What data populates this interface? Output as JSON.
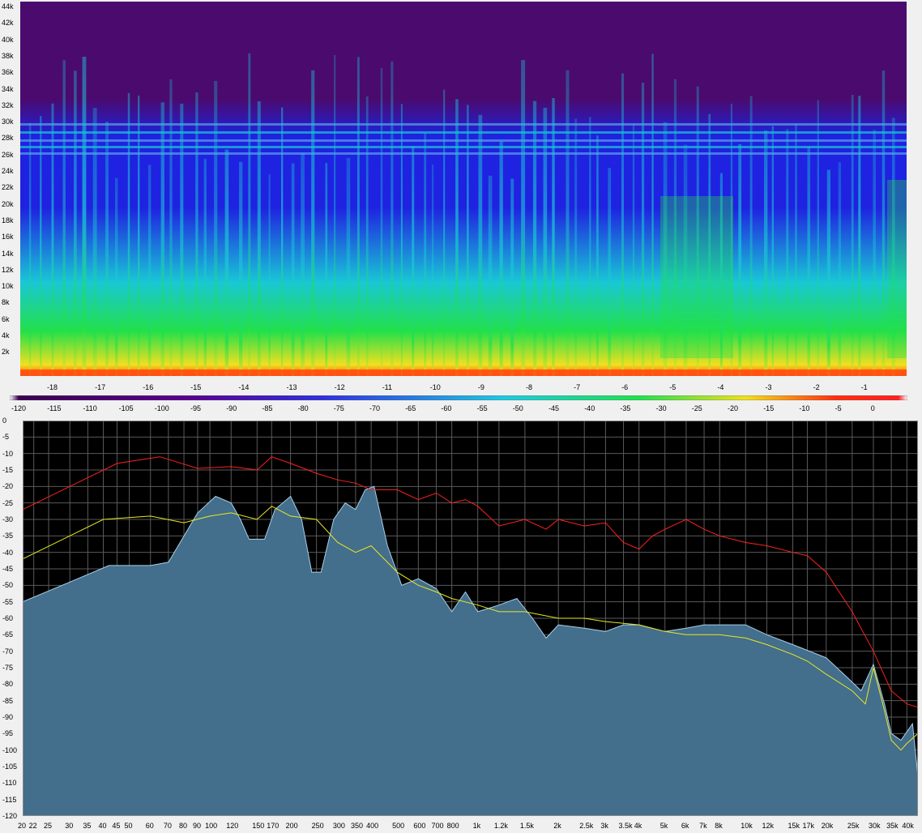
{
  "spectrogram": {
    "freq_ticks": [
      "44k",
      "42k",
      "40k",
      "38k",
      "36k",
      "34k",
      "32k",
      "30k",
      "28k",
      "26k",
      "24k",
      "22k",
      "20k",
      "18k",
      "16k",
      "14k",
      "12k",
      "10k",
      "8k",
      "6k",
      "4k",
      "2k"
    ],
    "time_ticks": [
      "-18",
      "-17",
      "-16",
      "-15",
      "-14",
      "-13",
      "-12",
      "-11",
      "-10",
      "-9",
      "-8",
      "-7",
      "-6",
      "-5",
      "-4",
      "-3",
      "-2",
      "-1"
    ],
    "colors": {
      "low": "#4a0a6e",
      "mid": "#1f22e0",
      "cyan": "#19c7d6",
      "green": "#22e04a",
      "hot": "#f0e020",
      "peak": "#ff5010"
    }
  },
  "color_scale": {
    "ticks": [
      "-120",
      "-115",
      "-110",
      "-105",
      "-100",
      "-95",
      "-90",
      "-85",
      "-80",
      "-75",
      "-70",
      "-65",
      "-60",
      "-55",
      "-50",
      "-45",
      "-40",
      "-35",
      "-30",
      "-25",
      "-20",
      "-15",
      "-10",
      "-5",
      "0"
    ]
  },
  "chart_data": {
    "type": "area",
    "x_scale": "log",
    "xlim": [
      20,
      44000
    ],
    "ylim": [
      -120,
      0
    ],
    "grid": true,
    "x_ticks": [
      "20",
      "22",
      "25",
      "30",
      "35",
      "40",
      "45",
      "50",
      "60",
      "70",
      "80",
      "90",
      "100",
      "120",
      "150",
      "170",
      "200",
      "250",
      "300",
      "350",
      "400",
      "500",
      "600",
      "700",
      "800",
      "1k",
      "1.2k",
      "1.5k",
      "2k",
      "2.5k",
      "3k",
      "3.5k",
      "4k",
      "5k",
      "6k",
      "7k",
      "8k",
      "10k",
      "12k",
      "15k",
      "17k",
      "20k",
      "25k",
      "30k",
      "35k",
      "40k"
    ],
    "y_ticks": [
      "0",
      "-5",
      "-10",
      "-15",
      "-20",
      "-25",
      "-30",
      "-35",
      "-40",
      "-45",
      "-50",
      "-55",
      "-60",
      "-65",
      "-70",
      "-75",
      "-80",
      "-85",
      "-90",
      "-95",
      "-100",
      "-105",
      "-110",
      "-115",
      "-120"
    ],
    "series": [
      {
        "color": "#ff2020",
        "points": [
          [
            20,
            -27
          ],
          [
            30,
            -20
          ],
          [
            45,
            -13
          ],
          [
            65,
            -11
          ],
          [
            90,
            -14.5
          ],
          [
            120,
            -14
          ],
          [
            150,
            -15
          ],
          [
            170,
            -11
          ],
          [
            200,
            -13
          ],
          [
            250,
            -16
          ],
          [
            300,
            -18
          ],
          [
            350,
            -19
          ],
          [
            400,
            -21
          ],
          [
            500,
            -21
          ],
          [
            600,
            -24
          ],
          [
            700,
            -22
          ],
          [
            800,
            -25
          ],
          [
            900,
            -24
          ],
          [
            1000,
            -26
          ],
          [
            1200,
            -32
          ],
          [
            1500,
            -30
          ],
          [
            1800,
            -33
          ],
          [
            2000,
            -30
          ],
          [
            2500,
            -32
          ],
          [
            3000,
            -31
          ],
          [
            3500,
            -37
          ],
          [
            4000,
            -39
          ],
          [
            4500,
            -35
          ],
          [
            5000,
            -33
          ],
          [
            6000,
            -30
          ],
          [
            7000,
            -33
          ],
          [
            8000,
            -35
          ],
          [
            10000,
            -37
          ],
          [
            12000,
            -38
          ],
          [
            15000,
            -40
          ],
          [
            17000,
            -41
          ],
          [
            20000,
            -46
          ],
          [
            25000,
            -58
          ],
          [
            30000,
            -70
          ],
          [
            35000,
            -82
          ],
          [
            40000,
            -86
          ],
          [
            44000,
            -87
          ]
        ]
      },
      {
        "color": "#e8e820",
        "points": [
          [
            20,
            -42
          ],
          [
            30,
            -35
          ],
          [
            40,
            -30
          ],
          [
            60,
            -29
          ],
          [
            80,
            -31
          ],
          [
            100,
            -29
          ],
          [
            120,
            -28
          ],
          [
            150,
            -30
          ],
          [
            170,
            -26
          ],
          [
            200,
            -29
          ],
          [
            250,
            -30
          ],
          [
            300,
            -37
          ],
          [
            350,
            -40
          ],
          [
            400,
            -38
          ],
          [
            500,
            -46
          ],
          [
            600,
            -50
          ],
          [
            700,
            -52
          ],
          [
            800,
            -54
          ],
          [
            1000,
            -56
          ],
          [
            1200,
            -58
          ],
          [
            1500,
            -58
          ],
          [
            2000,
            -60
          ],
          [
            2500,
            -60
          ],
          [
            3000,
            -61
          ],
          [
            4000,
            -62
          ],
          [
            5000,
            -64
          ],
          [
            6000,
            -65
          ],
          [
            8000,
            -65
          ],
          [
            10000,
            -66
          ],
          [
            12000,
            -68
          ],
          [
            15000,
            -71
          ],
          [
            17000,
            -73
          ],
          [
            20000,
            -77
          ],
          [
            25000,
            -82
          ],
          [
            28000,
            -86
          ],
          [
            30000,
            -75
          ],
          [
            33000,
            -88
          ],
          [
            35000,
            -97
          ],
          [
            38000,
            -100
          ],
          [
            40000,
            -98
          ],
          [
            44000,
            -95
          ]
        ]
      },
      {
        "color": "#436e8c",
        "outline": "#a8d0e8",
        "points": [
          [
            20,
            -55
          ],
          [
            30,
            -49
          ],
          [
            42,
            -44
          ],
          [
            60,
            -44
          ],
          [
            70,
            -43
          ],
          [
            90,
            -28
          ],
          [
            105,
            -23
          ],
          [
            120,
            -25
          ],
          [
            130,
            -30
          ],
          [
            140,
            -36
          ],
          [
            160,
            -36
          ],
          [
            175,
            -27
          ],
          [
            200,
            -23
          ],
          [
            220,
            -30
          ],
          [
            240,
            -46
          ],
          [
            260,
            -46
          ],
          [
            290,
            -30
          ],
          [
            320,
            -25
          ],
          [
            350,
            -27
          ],
          [
            380,
            -21
          ],
          [
            410,
            -20
          ],
          [
            460,
            -38
          ],
          [
            520,
            -50
          ],
          [
            600,
            -48
          ],
          [
            700,
            -51
          ],
          [
            800,
            -58
          ],
          [
            900,
            -52
          ],
          [
            1000,
            -58
          ],
          [
            1200,
            -56
          ],
          [
            1400,
            -54
          ],
          [
            1600,
            -60
          ],
          [
            1800,
            -66
          ],
          [
            2000,
            -62
          ],
          [
            2500,
            -63
          ],
          [
            3000,
            -64
          ],
          [
            3500,
            -62
          ],
          [
            4000,
            -62
          ],
          [
            5000,
            -64
          ],
          [
            6000,
            -63
          ],
          [
            7000,
            -62
          ],
          [
            8000,
            -62
          ],
          [
            10000,
            -62
          ],
          [
            12000,
            -65
          ],
          [
            15000,
            -68
          ],
          [
            20000,
            -72
          ],
          [
            24000,
            -78
          ],
          [
            27000,
            -82
          ],
          [
            30000,
            -74
          ],
          [
            33000,
            -86
          ],
          [
            35000,
            -95
          ],
          [
            38000,
            -97
          ],
          [
            42000,
            -92
          ],
          [
            44000,
            -108
          ]
        ]
      }
    ]
  }
}
